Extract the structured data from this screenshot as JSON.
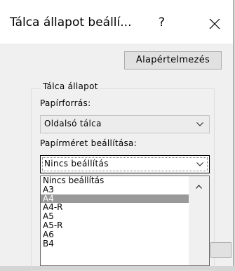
{
  "dialog": {
    "title": "Tálca állapot beállí...",
    "help_symbol": "?"
  },
  "buttons": {
    "default_label": "Alapértelmezés"
  },
  "group": {
    "legend": "Tálca állapot",
    "paper_source_label": "Papírforrás:",
    "paper_source_value": "Oldalsó tálca",
    "paper_size_label": "Papírméret beállítása:",
    "paper_size_value": "Nincs beállítás"
  },
  "dropdown": {
    "items": [
      "Nincs beállítás",
      "A3",
      "A4",
      "A4-R",
      "A5",
      "A5-R",
      "A6",
      "B4"
    ],
    "selected": "A4"
  },
  "icons": {
    "close": "close-icon",
    "chevron": "chevron-down-icon",
    "scroll_up": "chevron-up-icon"
  },
  "colors": {
    "dialog_bg": "#f0f0f0",
    "title_bg": "#ffffff",
    "selection": "#999999"
  }
}
